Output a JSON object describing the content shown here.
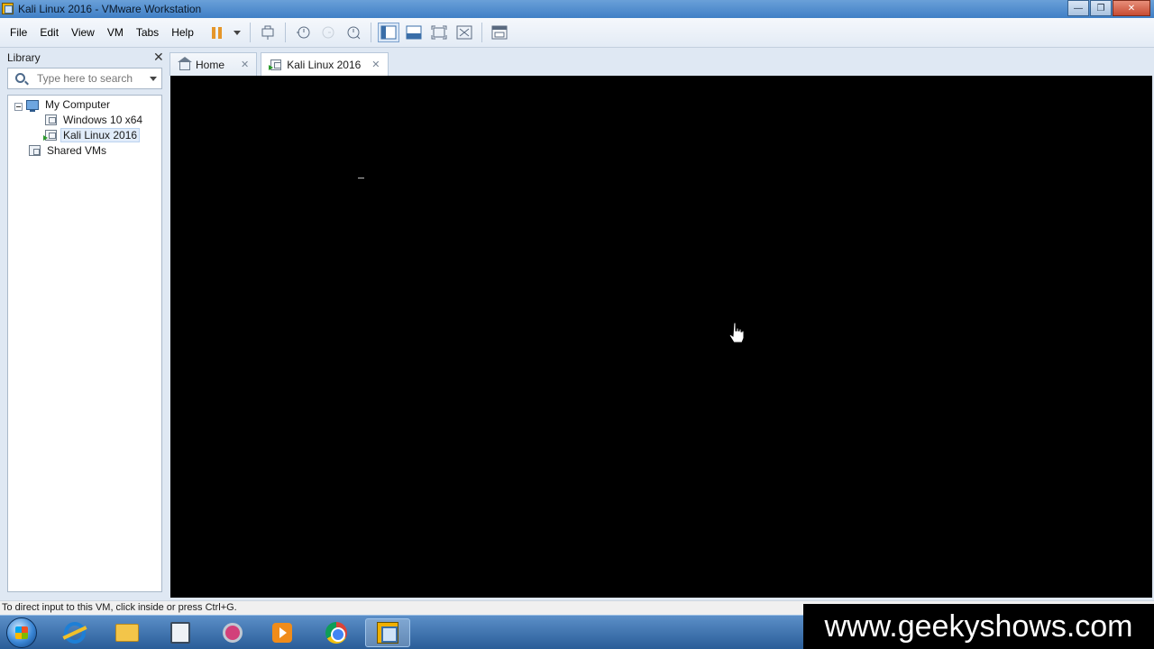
{
  "window": {
    "title": "Kali Linux 2016 - VMware Workstation",
    "controls": [
      "minimize",
      "maximize",
      "close"
    ]
  },
  "menu": [
    "File",
    "Edit",
    "View",
    "VM",
    "Tabs",
    "Help"
  ],
  "toolbar": {
    "icons": [
      "pause-icon",
      "send-ctrl-alt-del-icon",
      "snapshot-icon",
      "revert-snapshot-icon",
      "snapshot-manager-icon",
      "show-library-icon",
      "unity-icon",
      "full-screen-icon",
      "fit-guest-icon",
      "console-view-icon"
    ]
  },
  "library": {
    "header": "Library",
    "search_placeholder": "Type here to search",
    "tree": {
      "my_computer": "My Computer",
      "windows_vm": "Windows 10 x64",
      "kali_vm": "Kali Linux 2016",
      "shared_vms": "Shared VMs"
    }
  },
  "tabs": [
    {
      "label": "Home"
    },
    {
      "label": "Kali Linux 2016"
    }
  ],
  "status": {
    "message": "To direct input to this VM, click inside or press Ctrl+G."
  },
  "taskbar": {
    "apps": [
      "start-button",
      "internet-explorer-icon",
      "file-explorer-icon",
      "reader-icon",
      "snipping-tool-icon",
      "media-player-icon",
      "chrome-icon",
      "vmware-workstation-icon"
    ]
  },
  "watermark": "www.geekyshows.com"
}
